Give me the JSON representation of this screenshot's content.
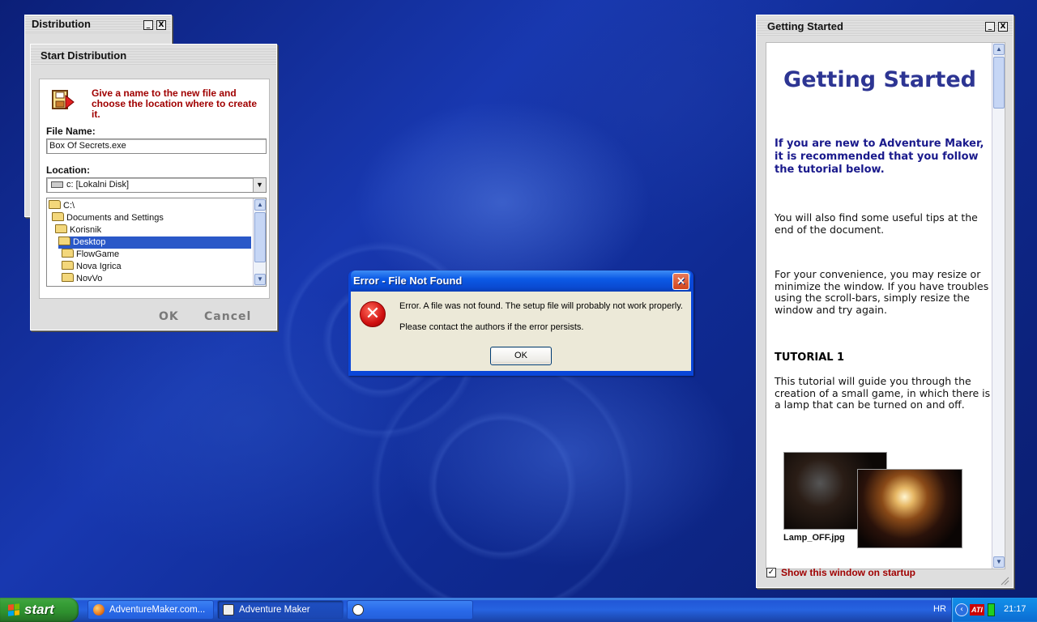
{
  "distribution": {
    "title": "Distribution",
    "minimize": "_",
    "close": "X"
  },
  "start_distribution": {
    "title": "Start Distribution",
    "instruction": "Give a name to the new file and choose the location where to create it.",
    "file_name_label": "File Name:",
    "file_name_value": "Box Of Secrets.exe",
    "location_label": "Location:",
    "location_value": "c: [Lokalni Disk]",
    "folders": [
      {
        "label": "C:\\",
        "selected": false
      },
      {
        "label": "Documents and Settings",
        "selected": false
      },
      {
        "label": "Korisnik",
        "selected": false
      },
      {
        "label": "Desktop",
        "selected": true
      },
      {
        "label": "FlowGame",
        "selected": false
      },
      {
        "label": "Nova Igrica",
        "selected": false
      },
      {
        "label": "NovVo",
        "selected": false
      }
    ],
    "ok_label": "OK",
    "cancel_label": "Cancel"
  },
  "error_dialog": {
    "title": "Error - File Not Found",
    "close": "×",
    "icon": "error-icon",
    "message_line1": "Error. A file was not found. The setup file will probably not work properly.",
    "message_line2": "Please contact the authors if the error persists.",
    "ok_label": "OK"
  },
  "getting_started": {
    "title": "Getting Started",
    "minimize": "_",
    "close": "X",
    "heading": "Getting Started",
    "intro": "If you are new to Adventure Maker, it is recommended that you follow the tutorial below.",
    "tips": "You will also find some useful tips at the end of the document.",
    "resize_note": "For your convenience, you may resize or minimize the window. If you have troubles using the scroll-bars, simply resize the window and try again.",
    "tutorial_title": "TUTORIAL 1",
    "tutorial_text": "This tutorial will guide you through the creation of a small game, in which there is a lamp that can be turned on and off.",
    "image1_caption": "Lamp_OFF.jpg",
    "show_on_startup_label": "Show this window on startup",
    "show_on_startup_checked": true,
    "checkmark": "✓"
  },
  "taskbar": {
    "start_label": "start",
    "items": [
      {
        "label": "AdventureMaker.com...",
        "active": false,
        "icon_color": "#e8761c"
      },
      {
        "label": "Adventure Maker",
        "active": true,
        "icon_color": "#ffffff"
      },
      {
        "label": "",
        "active": false,
        "icon_color": "#ffffff"
      }
    ],
    "tray": {
      "language": "HR",
      "ati_label": "ATI",
      "clock": "21:17"
    }
  },
  "colors": {
    "desktop": "#1838b0",
    "xp_blue": "#0a46d8",
    "dialog_bg": "#ece9d8",
    "accent_red": "#a00000",
    "heading_blue": "#2d3593",
    "selection": "#2a58c8",
    "start_green": "#38a038"
  }
}
